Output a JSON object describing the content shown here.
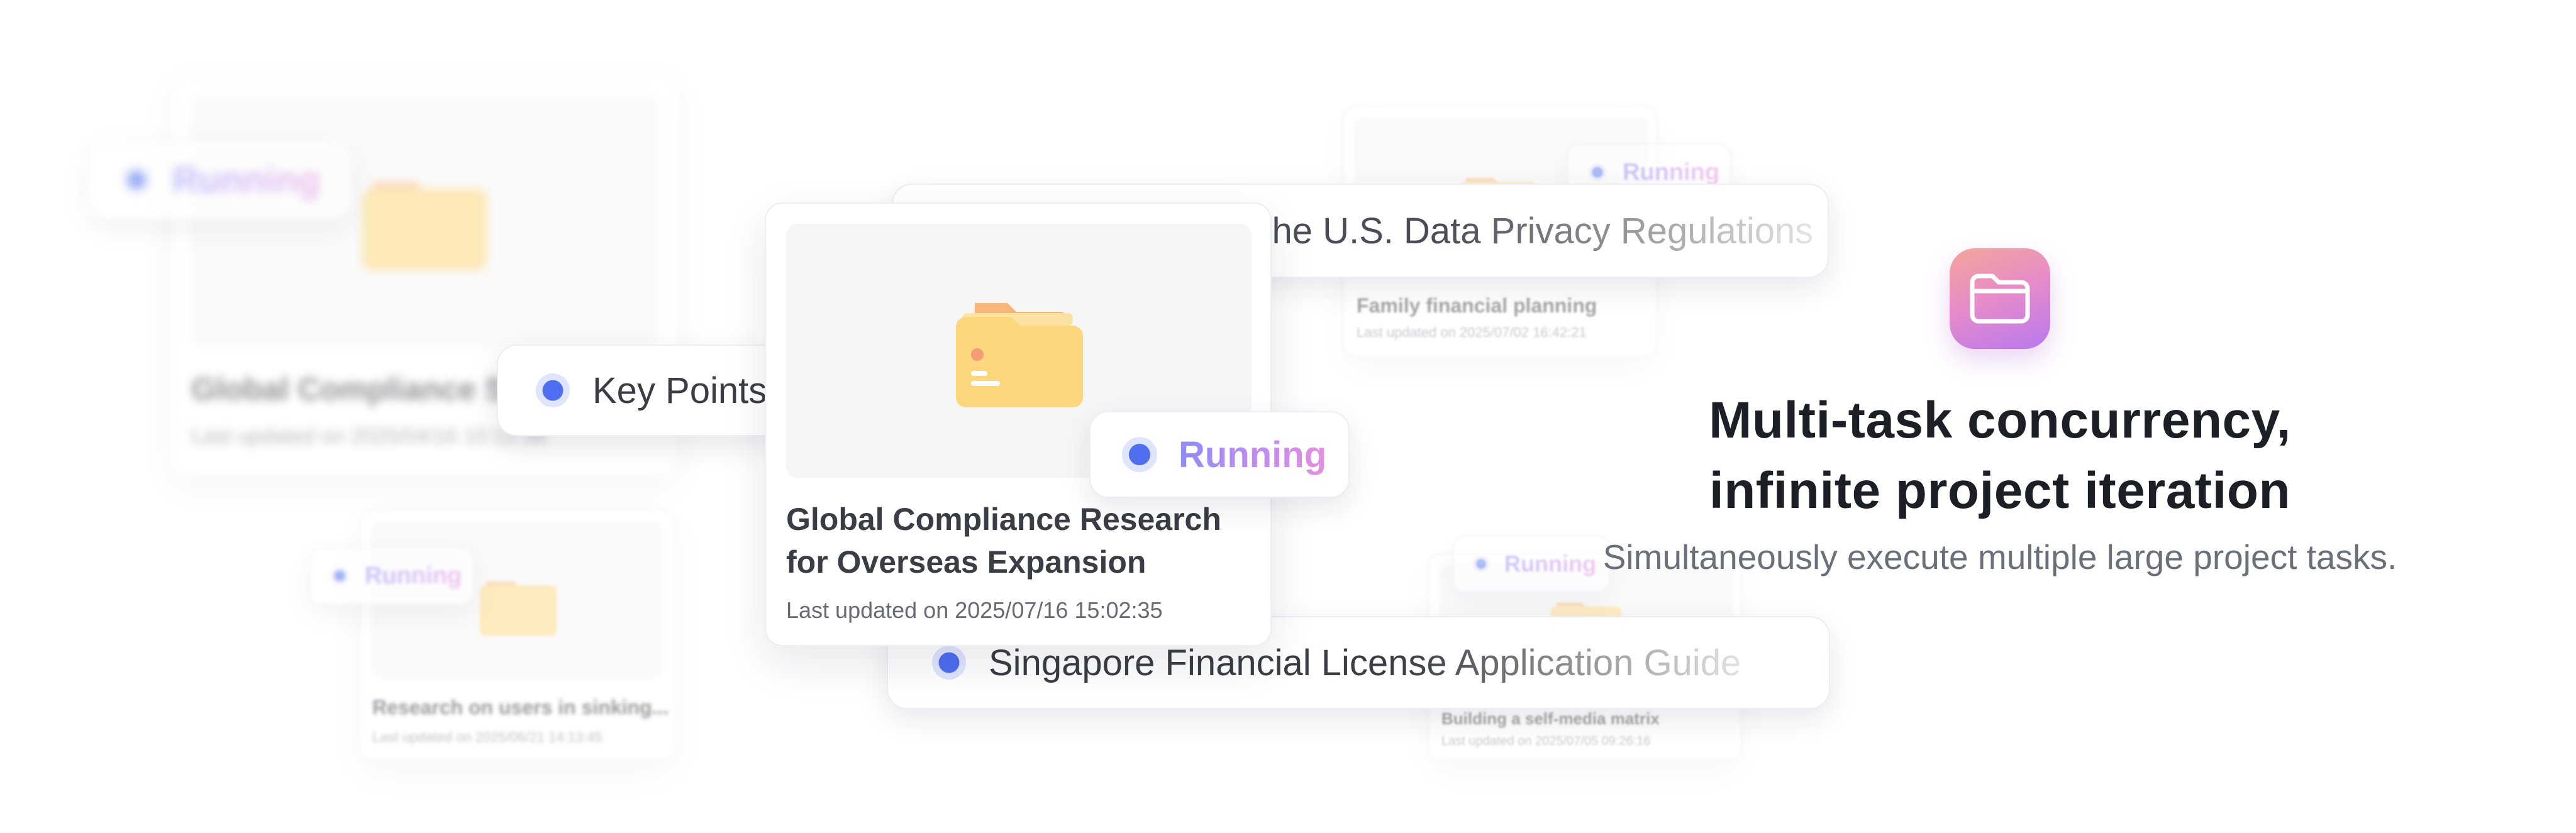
{
  "hero": {
    "title_line1": "Multi-task concurrency,",
    "title_line2": "infinite project iteration",
    "subtitle": "Simultaneously execute multiple large project tasks.",
    "icon": "folder-icon"
  },
  "main_card": {
    "title_line1": "Global Compliance Research",
    "title_line2": "for Overseas Expansion",
    "updated": "Last updated on 2025/07/16 15:02:35",
    "status": "Running"
  },
  "back_left_card": {
    "title": "Global Compliance S",
    "updated": "Last updated on 2025/04/16 10:12:36",
    "status": "Running"
  },
  "small_card": {
    "title": "Research on users in sinking...",
    "updated": "Last updated on 2025/06/21 14:13:45",
    "status": "Running"
  },
  "top_right_card": {
    "title": "Family financial planning",
    "updated": "Last updated on 2025/07/02 16:42:21",
    "status": "Running"
  },
  "bottom_right_card": {
    "title": "Building a self-media matrix",
    "updated": "Last updated on 2025/07/05 09:26:16",
    "status": "Running"
  },
  "pills": {
    "key_points": "Key Points",
    "privacy": "Interpretation of the U.S. Data Privacy Regulations",
    "singapore": "Singapore Financial License Application Guide"
  },
  "colors": {
    "accent_blue": "#4f6ef0",
    "running_gradient_start": "#8f8cf6",
    "running_gradient_end": "#e48fe0",
    "folder_yellow": "#fcd77e",
    "folder_back": "#f8b77a"
  }
}
